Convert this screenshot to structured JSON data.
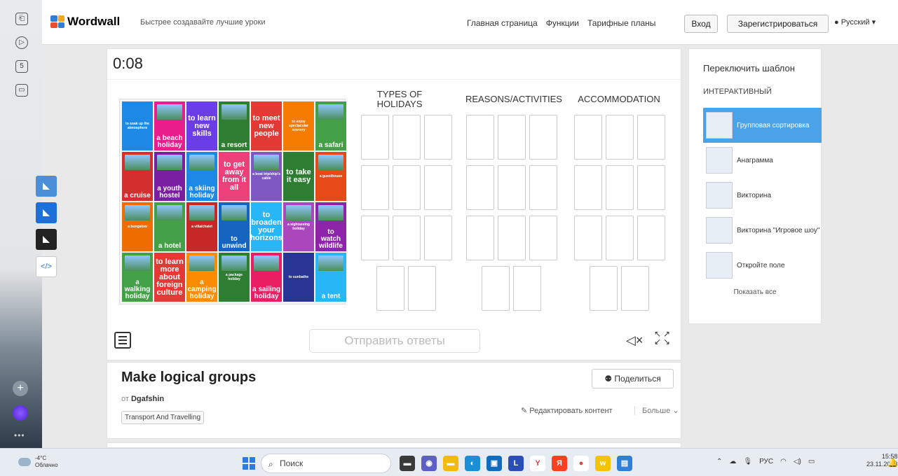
{
  "brand": {
    "name": "Wordwall",
    "tagline": "Быстрее создавайте лучшие уроки"
  },
  "nav": [
    "Главная страница",
    "Функции",
    "Тарифные планы"
  ],
  "auth": {
    "login": "Вход",
    "register": "Зарегистрироваться"
  },
  "language": "Русский",
  "game": {
    "timer": "0:08",
    "tiles": [
      {
        "text": "to soak up the atmosphere",
        "color": "#1e88e5",
        "size": "small",
        "pic": false
      },
      {
        "text": "a beach holiday",
        "color": "#e91e8c",
        "size": "normal",
        "pic": true
      },
      {
        "text": "to learn new skills",
        "color": "#6a3de8",
        "size": "big",
        "pic": false
      },
      {
        "text": "a resort",
        "color": "#2e7d32",
        "size": "normal",
        "pic": true
      },
      {
        "text": "to meet new people",
        "color": "#e53935",
        "size": "big",
        "pic": false
      },
      {
        "text": "to enjoy spectacular scenery",
        "color": "#f57c00",
        "size": "small",
        "pic": false
      },
      {
        "text": "a safari",
        "color": "#43a047",
        "size": "normal",
        "pic": true
      },
      {
        "text": "a cruise",
        "color": "#d32f2f",
        "size": "normal",
        "pic": true
      },
      {
        "text": "a youth hostel",
        "color": "#7b1fa2",
        "size": "normal",
        "pic": true
      },
      {
        "text": "a skiing holiday",
        "color": "#1e88e5",
        "size": "normal",
        "pic": true
      },
      {
        "text": "to get away from it all",
        "color": "#ec407a",
        "size": "big",
        "pic": false
      },
      {
        "text": "a boat trip/ship's cable",
        "color": "#7e57c2",
        "size": "small",
        "pic": true
      },
      {
        "text": "to take it easy",
        "color": "#2e7d32",
        "size": "big",
        "pic": false
      },
      {
        "text": "a guesthouse",
        "color": "#e64a19",
        "size": "small",
        "pic": true
      },
      {
        "text": "a bungalow",
        "color": "#ef6c00",
        "size": "small",
        "pic": true
      },
      {
        "text": "a hotel",
        "color": "#43a047",
        "size": "normal",
        "pic": true
      },
      {
        "text": "a villa/chalet",
        "color": "#c62828",
        "size": "small",
        "pic": true
      },
      {
        "text": "to unwind",
        "color": "#1565c0",
        "size": "normal",
        "pic": true
      },
      {
        "text": "to broaden your horizons",
        "color": "#29b6f6",
        "size": "big",
        "pic": false
      },
      {
        "text": "a sightseeing holiday",
        "color": "#ab47bc",
        "size": "small",
        "pic": true
      },
      {
        "text": "to watch wildlife",
        "color": "#8e24aa",
        "size": "normal",
        "pic": true
      },
      {
        "text": "a walking holiday",
        "color": "#43a047",
        "size": "normal",
        "pic": true
      },
      {
        "text": "to learn more about foreign culture",
        "color": "#e53935",
        "size": "big",
        "pic": false
      },
      {
        "text": "a camping holiday",
        "color": "#fb8c00",
        "size": "normal",
        "pic": true
      },
      {
        "text": "a package holiday",
        "color": "#2e7d32",
        "size": "small",
        "pic": true
      },
      {
        "text": "a sailing holiday",
        "color": "#e91e63",
        "size": "normal",
        "pic": true
      },
      {
        "text": "to sunbathe",
        "color": "#283593",
        "size": "small",
        "pic": false
      },
      {
        "text": "a tent",
        "color": "#29b6f6",
        "size": "normal",
        "pic": true
      }
    ],
    "groups": [
      "TYPES OF HOLIDAYS",
      "REASONS/ACTIVITIES",
      "ACCOMMODATION"
    ],
    "submit": "Отправить ответы"
  },
  "activity": {
    "title": "Make logical groups",
    "share": "Поделиться",
    "author_prefix": "от",
    "author": "Dgafshin",
    "edit": "Редактировать контент",
    "more": "Больше",
    "tag": "Transport And Travelling"
  },
  "switcher": {
    "title": "Переключить шаблон",
    "section": "ИНТЕРАКТИВНЫЙ",
    "items": [
      {
        "label": "Групповая сортировка",
        "active": true
      },
      {
        "label": "Анаграмма",
        "active": false
      },
      {
        "label": "Викторина",
        "active": false
      },
      {
        "label": "Викторина \"Игровое шоу\"",
        "active": false
      },
      {
        "label": "Откройте поле",
        "active": false
      }
    ],
    "show_all": "Показать все"
  },
  "taskbar": {
    "weather_temp": "-4°C",
    "weather_desc": "Облачно",
    "search": "Поиск",
    "lang": "РУС",
    "time": "15:58",
    "date": "23.11.2023",
    "apps": [
      {
        "label": "▬",
        "color": "#3a3a3a"
      },
      {
        "label": "◉",
        "color": "#5b5fc7"
      },
      {
        "label": "▬",
        "color": "#f2b90f"
      },
      {
        "label": "◐",
        "color": "#1a8fd6"
      },
      {
        "label": "▣",
        "color": "#0f6cbd"
      },
      {
        "label": "L",
        "color": "#2b4db8"
      },
      {
        "label": "Y",
        "color": "#ffffff"
      },
      {
        "label": "Я",
        "color": "#fc3f1d"
      },
      {
        "label": "●",
        "color": "#ffffff"
      },
      {
        "label": "ᴡ",
        "color": "#f5c400"
      },
      {
        "label": "▤",
        "color": "#2f7fd8"
      }
    ]
  }
}
